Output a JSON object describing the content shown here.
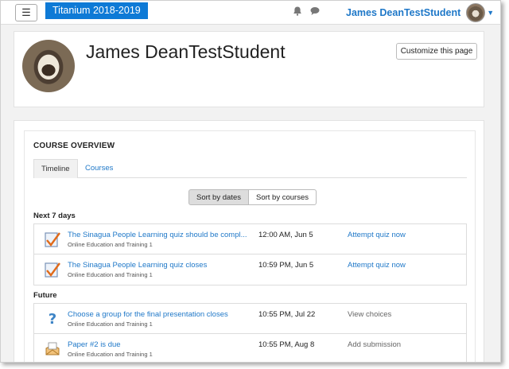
{
  "navbar": {
    "menu_icon": "hamburger-icon",
    "site_name": "Titanium 2018-2019",
    "notification_icon": "bell-icon",
    "messages_icon": "chat-bubble-icon",
    "user_name": "James DeanTestStudent"
  },
  "header": {
    "title": "James DeanTestStudent",
    "customize_label": "Customize this page"
  },
  "overview": {
    "title": "COURSE OVERVIEW",
    "tabs": [
      {
        "label": "Timeline",
        "active": true
      },
      {
        "label": "Courses",
        "active": false
      }
    ],
    "sort": [
      {
        "label": "Sort by dates",
        "active": true
      },
      {
        "label": "Sort by courses",
        "active": false
      }
    ],
    "sections": [
      {
        "label": "Next 7 days",
        "events": [
          {
            "icon": "quiz-icon",
            "name": "The Sinagua People Learning quiz should be compl...",
            "course": "Online Education and Training 1",
            "time": "12:00 AM, Jun 5",
            "action": "Attempt quiz now",
            "action_link": true
          },
          {
            "icon": "quiz-icon",
            "name": "The Sinagua People Learning quiz closes",
            "course": "Online Education and Training 1",
            "time": "10:59 PM, Jun 5",
            "action": "Attempt quiz now",
            "action_link": true
          }
        ]
      },
      {
        "label": "Future",
        "events": [
          {
            "icon": "question-icon",
            "name": "Choose a group for the final presentation closes",
            "course": "Online Education and Training 1",
            "time": "10:55 PM, Jul 22",
            "action": "View choices",
            "action_link": false
          },
          {
            "icon": "assignment-icon",
            "name": "Paper #2 is due",
            "course": "Online Education and Training 1",
            "time": "10:55 PM, Aug 8",
            "action": "Add submission",
            "action_link": false
          }
        ]
      }
    ]
  },
  "colors": {
    "accent": "#0e7ad6",
    "link": "#1f78c8"
  }
}
